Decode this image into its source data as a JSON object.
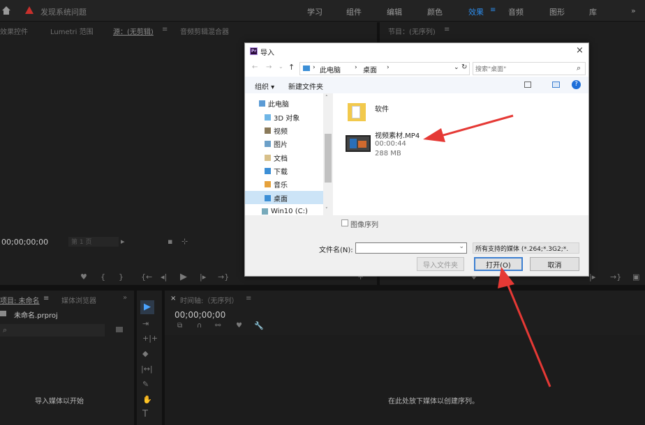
{
  "topbar": {
    "title": "发现系统问题",
    "workspaces": [
      "学习",
      "组件",
      "编辑",
      "颜色",
      "效果",
      "音频",
      "图形",
      "库"
    ],
    "active_workspace": "效果",
    "overflow": "»"
  },
  "source_panel": {
    "tabs": [
      "效果控件",
      "Lumetri 范围",
      "源：(无剪辑)",
      "音频剪辑混合器"
    ],
    "timecode": "00;00;00;00",
    "fit": "第 1 页"
  },
  "program_panel": {
    "tab": "节目：(无序列)"
  },
  "project_panel": {
    "tabs": [
      "项目: 未命名",
      "媒体浏览器"
    ],
    "file": "未命名.prproj",
    "empty_text": "导入媒体以开始"
  },
  "timeline_panel": {
    "tab": "时间轴:（无序列）",
    "timecode": "00;00;00;00",
    "empty_text": "在此处放下媒体以创建序列。"
  },
  "dialog": {
    "title": "导入",
    "breadcrumb": [
      "此电脑",
      "桌面"
    ],
    "search_placeholder": "搜索\"桌面\"",
    "toolbar": {
      "organize": "组织",
      "new_folder": "新建文件夹"
    },
    "nav": [
      "此电脑",
      "3D 对象",
      "视频",
      "图片",
      "文档",
      "下载",
      "音乐",
      "桌面",
      "Win10 (C:)"
    ],
    "selected_nav": "桌面",
    "folder": {
      "name": "软件"
    },
    "video": {
      "name": "视频素材.MP4",
      "duration": "00:00:44",
      "size": "288 MB"
    },
    "image_sequence": "图像序列",
    "filename_label": "文件名(N):",
    "filetype": "所有支持的媒体 (*.264;*.3G2;*.",
    "buttons": {
      "import_folder": "导入文件夹",
      "open": "打开(O)",
      "cancel": "取消"
    }
  },
  "colors": {
    "accent": "#2d8ceb",
    "arrow": "#e53935",
    "warning": "#c9302c"
  }
}
